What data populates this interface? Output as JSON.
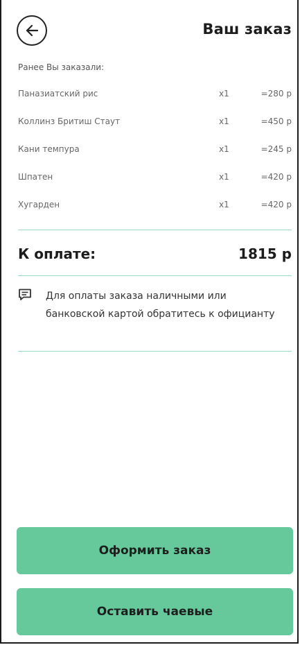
{
  "header": {
    "title": "Ваш заказ",
    "back_icon": "arrow-left-icon"
  },
  "order": {
    "previous_label": "Ранее Вы заказали:",
    "items": [
      {
        "name": "Паназиатский рис",
        "qty": "x1",
        "price": "=280 р"
      },
      {
        "name": "Коллинз Бритиш Стаут",
        "qty": "x1",
        "price": "=450 р"
      },
      {
        "name": "Кани темпура",
        "qty": "x1",
        "price": "=245 р"
      },
      {
        "name": "Шпатен",
        "qty": "x1",
        "price": "=420 р"
      },
      {
        "name": "Хугарден",
        "qty": "x1",
        "price": "=420 р"
      }
    ]
  },
  "total": {
    "label": "К оплате:",
    "value": "1815 р"
  },
  "notice": {
    "icon": "message-icon",
    "text": "Для оплаты заказа наличными или банковской картой обратитесь к официанту"
  },
  "actions": {
    "order_label": "Оформить заказ",
    "tips_label": "Оставить чаевые"
  },
  "colors": {
    "accent": "#66c99c",
    "divider": "#9fdcc4"
  }
}
